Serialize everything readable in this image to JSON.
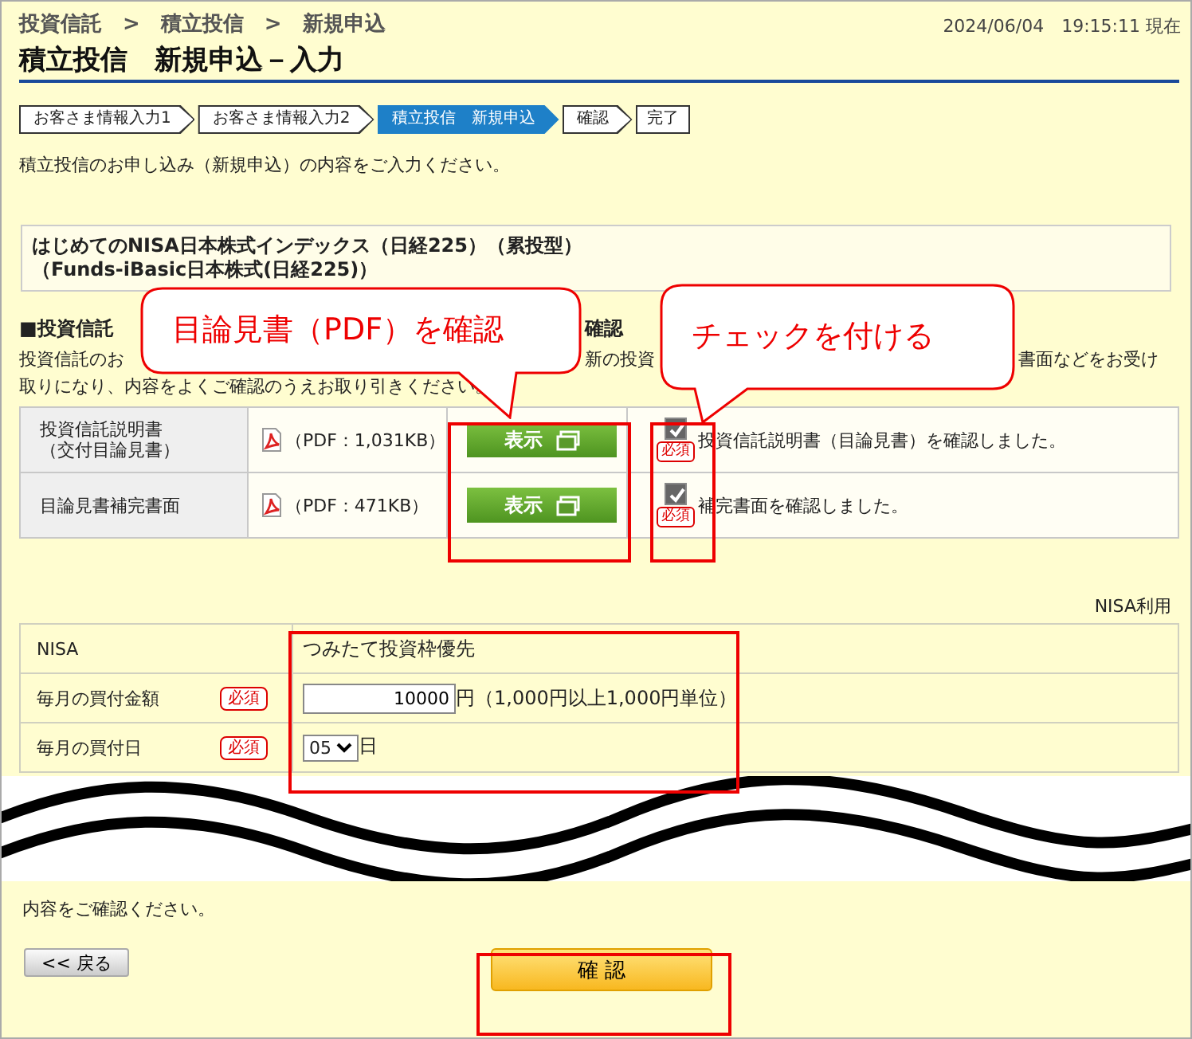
{
  "breadcrumb": "投資信託　>　積立投信　>　新規申込",
  "timestamp": "2024/06/04　19:15:11 現在",
  "title": "積立投信　新規申込－入力",
  "steps": [
    {
      "label": "お客さま情報入力1",
      "selected": false
    },
    {
      "label": "お客さま情報入力2",
      "selected": false
    },
    {
      "label": "積立投信　新規申込",
      "selected": true
    },
    {
      "label": "確認",
      "selected": false
    },
    {
      "label": "完了",
      "selected": false
    }
  ],
  "intro": "積立投信のお申し込み（新規申込）の内容をご入力ください。",
  "fund_name": [
    "はじめてのNISA日本株式インデックス（日経225）（累投型）",
    "（Funds-iBasic日本株式(日経225)）"
  ],
  "section_heading": [
    "■投資信託",
    "確認"
  ],
  "notice_line_1": [
    "投資信託のお",
    "新の投資",
    "書面などをお受け"
  ],
  "notice_line_2": "取りになり、内容をよくご確認のうえお取り引きください。",
  "documents": [
    {
      "name": "投資信託説明書（交付目論見書）",
      "file": "（PDF：1,031KB）",
      "button": "表示",
      "checked": true,
      "required": "必須",
      "confirm": "投資信託説明書（目論見書）を確認しました。"
    },
    {
      "name": "目論見書補完書面",
      "file": "（PDF：471KB）",
      "button": "表示",
      "checked": true,
      "required": "必須",
      "confirm": "補完書面を確認しました。"
    }
  ],
  "nisa_note": "NISA利用",
  "form_rows": [
    {
      "kind": "text",
      "label": "NISA",
      "value": "つみたて投資枠優先"
    },
    {
      "kind": "amount",
      "label": "毎月の買付金額",
      "required": "必須",
      "value": "10000",
      "unit": "円（1,000円以上1,000円単位）"
    },
    {
      "kind": "select",
      "label": "毎月の買付日",
      "required": "必須",
      "value": "05",
      "unit": "日"
    }
  ],
  "footer_text": "内容をご確認ください。",
  "back_button": "<< 戻る",
  "confirm_button": "確 認",
  "callouts": [
    "目論見書（PDF）を確認",
    "チェックを付ける"
  ]
}
